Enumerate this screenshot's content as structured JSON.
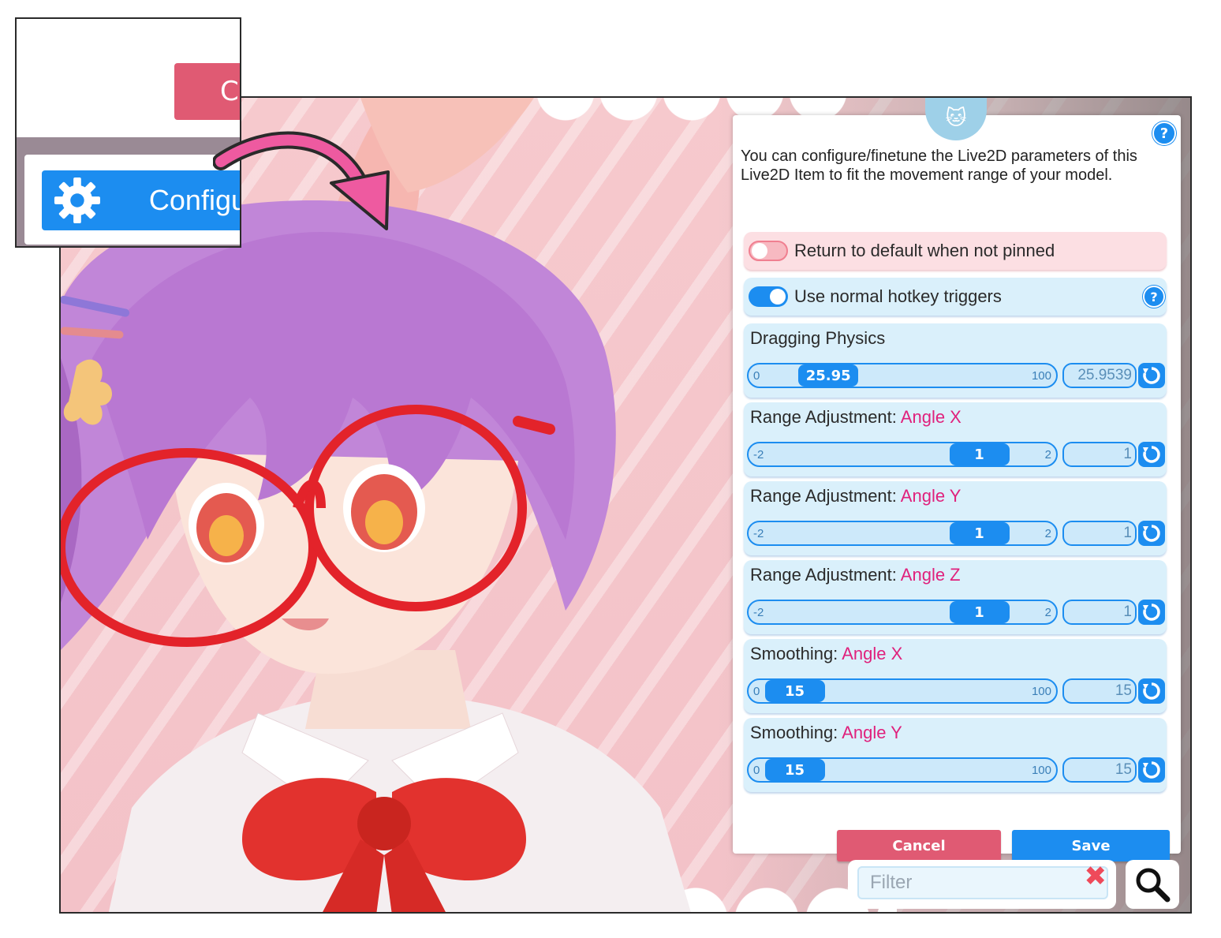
{
  "inset": {
    "cancel_partial": "Ca",
    "config_label_partial": "Configu"
  },
  "panel": {
    "description": "You can configure/finetune the Live2D parameters of this Live2D Item to fit the movement range of your model.",
    "help_symbol": "?",
    "toggles": [
      {
        "label": "Return to default when not pinned",
        "state": "off"
      },
      {
        "label": "Use normal hotkey triggers",
        "state": "on"
      }
    ],
    "params": [
      {
        "title": "Dragging Physics",
        "highlight": "",
        "min": "0",
        "max": "100",
        "thumb": "25.95",
        "value": "25.9539",
        "fraction": 0.2595
      },
      {
        "title": "Range Adjustment: ",
        "highlight": "Angle X",
        "min": "-2",
        "max": "2",
        "thumb": "1",
        "value": "1",
        "fraction": 0.75
      },
      {
        "title": "Range Adjustment: ",
        "highlight": "Angle Y",
        "min": "-2",
        "max": "2",
        "thumb": "1",
        "value": "1",
        "fraction": 0.75
      },
      {
        "title": "Range Adjustment: ",
        "highlight": "Angle Z",
        "min": "-2",
        "max": "2",
        "thumb": "1",
        "value": "1",
        "fraction": 0.75
      },
      {
        "title": "Smoothing: ",
        "highlight": "Angle X",
        "min": "0",
        "max": "100",
        "thumb": "15",
        "value": "15",
        "fraction": 0.15
      },
      {
        "title": "Smoothing: ",
        "highlight": "Angle Y",
        "min": "0",
        "max": "100",
        "thumb": "15",
        "value": "15",
        "fraction": 0.15
      }
    ],
    "cancel_label": "Cancel",
    "save_label": "Save"
  },
  "filter": {
    "placeholder": "Filter",
    "clear_icon": "x-icon",
    "search_icon": "magnifier-icon"
  },
  "colors": {
    "accent_blue": "#1c8df0",
    "cancel_red": "#e05a73",
    "highlight_magenta": "#e0217c",
    "row_blue": "#daf0fb",
    "row_pink": "#fcdfe3"
  }
}
